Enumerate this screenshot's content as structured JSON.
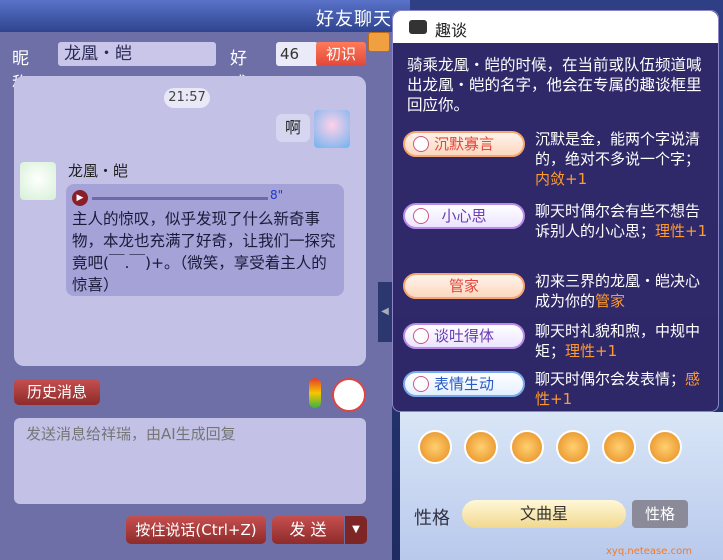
{
  "window": {
    "title": "好友聊天"
  },
  "header": {
    "nick_label": "昵称",
    "nick_value": "龙凰・皑",
    "fav_label": "好感",
    "fav_value": "46",
    "level_badge": "初识"
  },
  "chat": {
    "timestamp": "21:57",
    "my_message": "啊",
    "npc_name": "龙凰・皑",
    "voice_length": "8\"",
    "npc_message": "主人的惊叹，似乎发现了什么新奇事物，本龙也充满了好奇，让我们一探究竟吧(￣.￣)+。（微笑，享受着主人的惊喜）"
  },
  "controls": {
    "history_button": "历史消息",
    "input_placeholder": "发送消息给祥瑞，由AI生成回复",
    "voice_button": "按住说话(Ctrl+Z)",
    "send_button": "发 送"
  },
  "popup": {
    "title": "趣谈",
    "description": "骑乘龙凰・皑的时候，在当前或队伍频道喊出龙凰・皑的名字，他会在专属的趣谈框里回应你。",
    "traits": [
      {
        "name": "沉默寡言",
        "desc": "沉默是金，能两个字说清的，绝对不多说一个字；",
        "stat": "内敛+1",
        "style": "orange"
      },
      {
        "name": "小心思",
        "desc": "聊天时偶尔会有些不想告诉别人的小心思；",
        "stat": "理性+1",
        "style": "purple"
      },
      {
        "name": "管家",
        "desc": "初来三界的龙凰・皑决心成为你的",
        "stat": "管家",
        "style": "orange"
      },
      {
        "name": "谈吐得体",
        "desc": "聊天时礼貌和煦，中规中矩；",
        "stat": "理性+1",
        "style": "purple"
      },
      {
        "name": "表情生动",
        "desc": "聊天时偶尔会发表情；",
        "stat": "感性+1",
        "style": "blue"
      }
    ]
  },
  "bottom": {
    "label": "性格",
    "value": "文曲星",
    "button": "性格",
    "watermark": "xyq.netease.com"
  },
  "colors": {
    "accent": "#ff9a2e",
    "button_red": "#b23c3c",
    "panel": "#c3c2e6"
  }
}
